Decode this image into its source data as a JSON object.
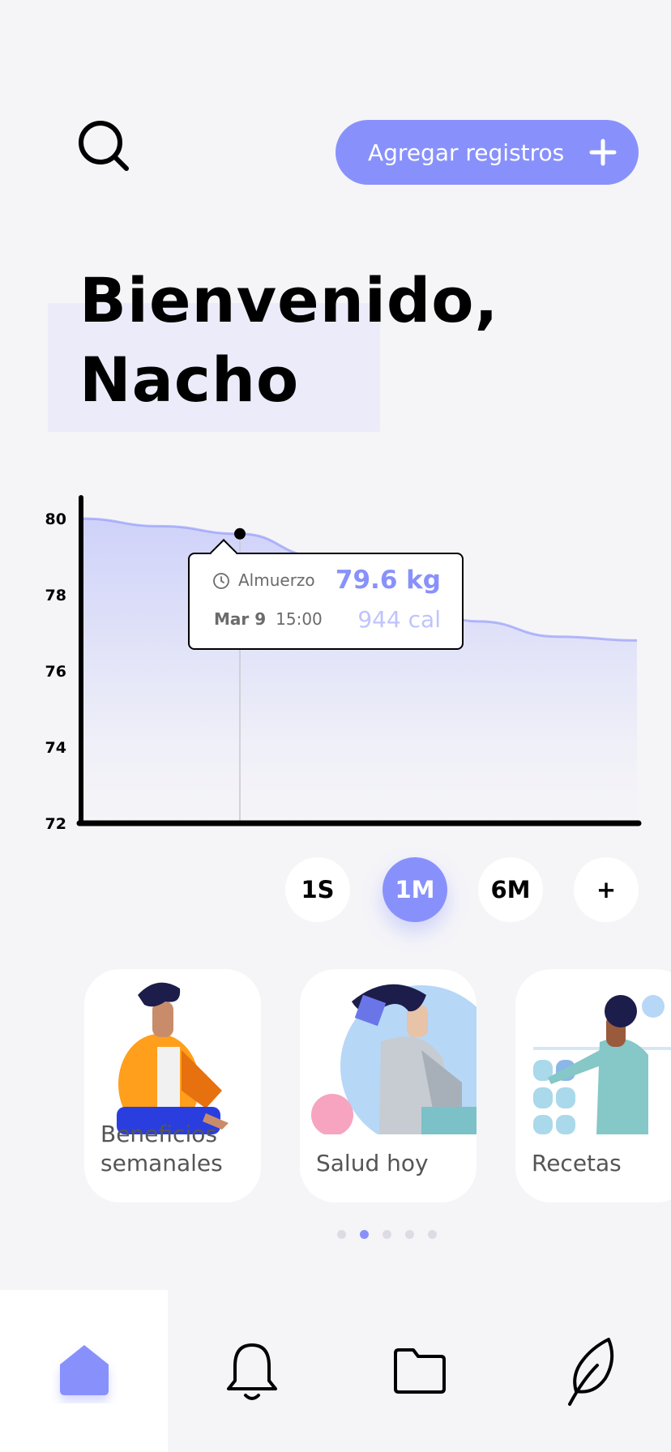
{
  "header": {
    "search_icon": "search-icon",
    "add_button_label": "Agregar registros",
    "add_icon": "plus-icon",
    "accent": "#8891fb"
  },
  "greeting": {
    "line1": "Bienvenido,",
    "line2": "Nacho"
  },
  "chart_data": {
    "type": "area",
    "y_ticks": [
      "80",
      "78",
      "76",
      "74",
      "72"
    ],
    "ylim": [
      72,
      80.5
    ],
    "x": [
      0,
      1,
      2,
      3,
      4,
      5,
      6,
      7
    ],
    "values": [
      80.0,
      79.8,
      79.6,
      79.0,
      77.9,
      77.3,
      76.9,
      76.8
    ],
    "highlight_index": 2,
    "grid": false,
    "color": "#8891fb"
  },
  "tooltip": {
    "meal": "Almuerzo",
    "date": "Mar 9",
    "time": "15:00",
    "weight": "79.6 kg",
    "calories": "944 cal"
  },
  "range_buttons": [
    {
      "label": "1S",
      "active": false
    },
    {
      "label": "1M",
      "active": true
    },
    {
      "label": "6M",
      "active": false
    },
    {
      "label": "+",
      "active": false
    }
  ],
  "cards": [
    {
      "line1": "Beneficios",
      "line2": "semanales"
    },
    {
      "line1": "Salud hoy",
      "line2": ""
    },
    {
      "line1": "Recetas",
      "line2": ""
    }
  ],
  "pager": {
    "count": 5,
    "active": 1
  },
  "tabbar": {
    "items": [
      "home-icon",
      "bell-icon",
      "folder-icon",
      "leaf-icon"
    ],
    "active": 0
  }
}
